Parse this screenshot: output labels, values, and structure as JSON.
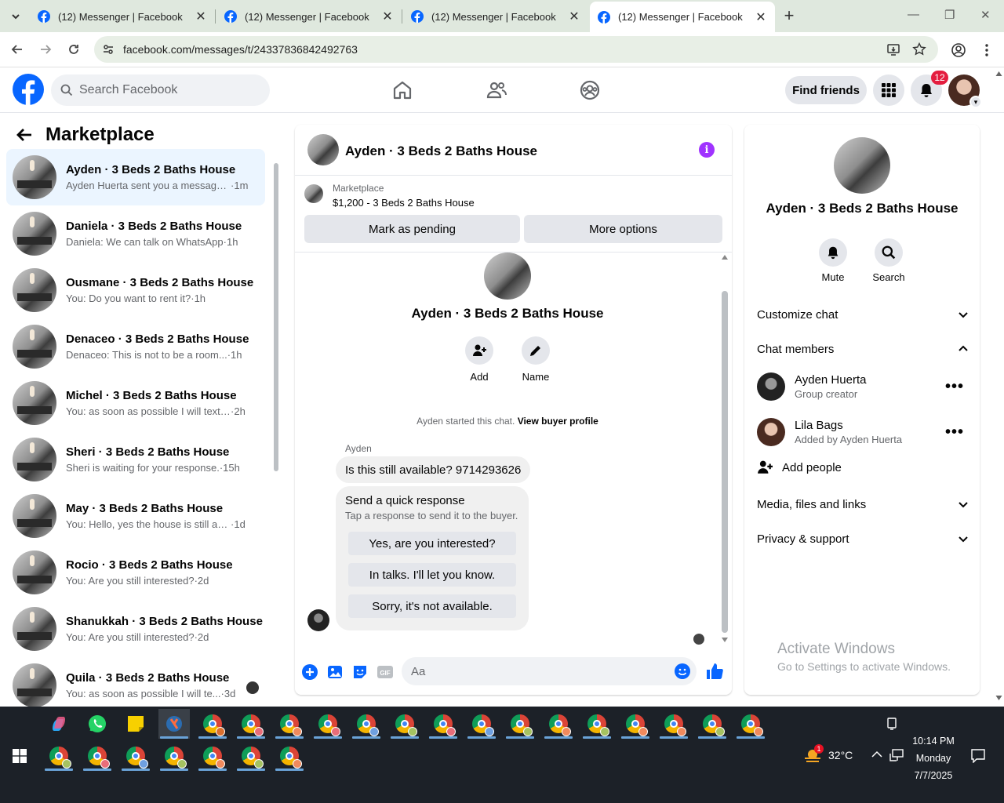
{
  "browser": {
    "tabs": [
      {
        "title": "(12) Messenger | Facebook"
      },
      {
        "title": "(12) Messenger | Facebook"
      },
      {
        "title": "(12) Messenger | Facebook"
      },
      {
        "title": "(12) Messenger | Facebook"
      }
    ],
    "active_tab": 3,
    "url": "facebook.com/messages/t/24337836842492763"
  },
  "fb": {
    "search_placeholder": "Search Facebook",
    "find_friends": "Find friends",
    "notif_count": "12",
    "brand_color": "#0866ff"
  },
  "left": {
    "title": "Marketplace",
    "conversations": [
      {
        "name": "Ayden · 3 Beds 2 Baths House",
        "preview": "Ayden Huerta sent you a message ...",
        "time": "1m",
        "selected": true
      },
      {
        "name": "Daniela · 3 Beds 2 Baths House",
        "preview": "Daniela: We can talk on WhatsApp",
        "time": "1h"
      },
      {
        "name": "Ousmane · 3 Beds 2 Baths House",
        "preview": "You: Do you want to rent it?",
        "time": "1h"
      },
      {
        "name": "Denaceo · 3 Beds 2 Baths House",
        "preview": "Denaceo: This is not to be a room...",
        "time": "1h"
      },
      {
        "name": "Michel · 3 Beds 2 Baths House",
        "preview": "You: as soon as possible I will text y...",
        "time": "2h"
      },
      {
        "name": "Sheri · 3 Beds 2 Baths House",
        "preview": "Sheri is waiting for your response.",
        "time": "15h"
      },
      {
        "name": "May · 3 Beds 2 Baths House",
        "preview": "You: Hello, yes the house is still avai...",
        "time": "1d"
      },
      {
        "name": "Rocio · 3 Beds 2 Baths House",
        "preview": "You: Are you still interested?",
        "time": "2d"
      },
      {
        "name": "Shanukkah · 3 Beds 2 Baths House",
        "preview": "You: Are you still interested?",
        "time": "2d"
      },
      {
        "name": "Quila · 3 Beds 2 Baths House",
        "preview": "You: as soon as possible I will te...",
        "time": "3d"
      }
    ]
  },
  "chat": {
    "title": "Ayden · 3 Beds 2 Baths House",
    "marketplace_label": "Marketplace",
    "listing": "$1,200 - 3 Beds 2 Baths House",
    "mark_pending": "Mark as pending",
    "more_options": "More options",
    "add_label": "Add",
    "name_label": "Name",
    "started_text": "Ayden started this chat.",
    "view_profile": "View buyer profile",
    "sender": "Ayden",
    "message": "Is this still available? 9714293626",
    "quick_title": "Send a quick response",
    "quick_sub": "Tap a response to send it to the buyer.",
    "quick_responses": [
      "Yes, are you interested?",
      "In talks. I'll let you know.",
      "Sorry, it's not available."
    ],
    "input_placeholder": "Aa"
  },
  "right": {
    "title": "Ayden · 3 Beds 2 Baths House",
    "mute": "Mute",
    "search": "Search",
    "customize": "Customize chat",
    "chat_members": "Chat members",
    "members": [
      {
        "name": "Ayden Huerta",
        "sub": "Group creator"
      },
      {
        "name": "Lila Bags",
        "sub": "Added by Ayden Huerta"
      }
    ],
    "add_people": "Add people",
    "media": "Media, files and links",
    "privacy": "Privacy & support"
  },
  "watermark": {
    "line1": "Activate Windows",
    "line2": "Go to Settings to activate Windows."
  },
  "taskbar": {
    "weather_temp": "32°C",
    "weather_badge": "1",
    "time": "10:14 PM",
    "day": "Monday",
    "date": "7/7/2025"
  }
}
